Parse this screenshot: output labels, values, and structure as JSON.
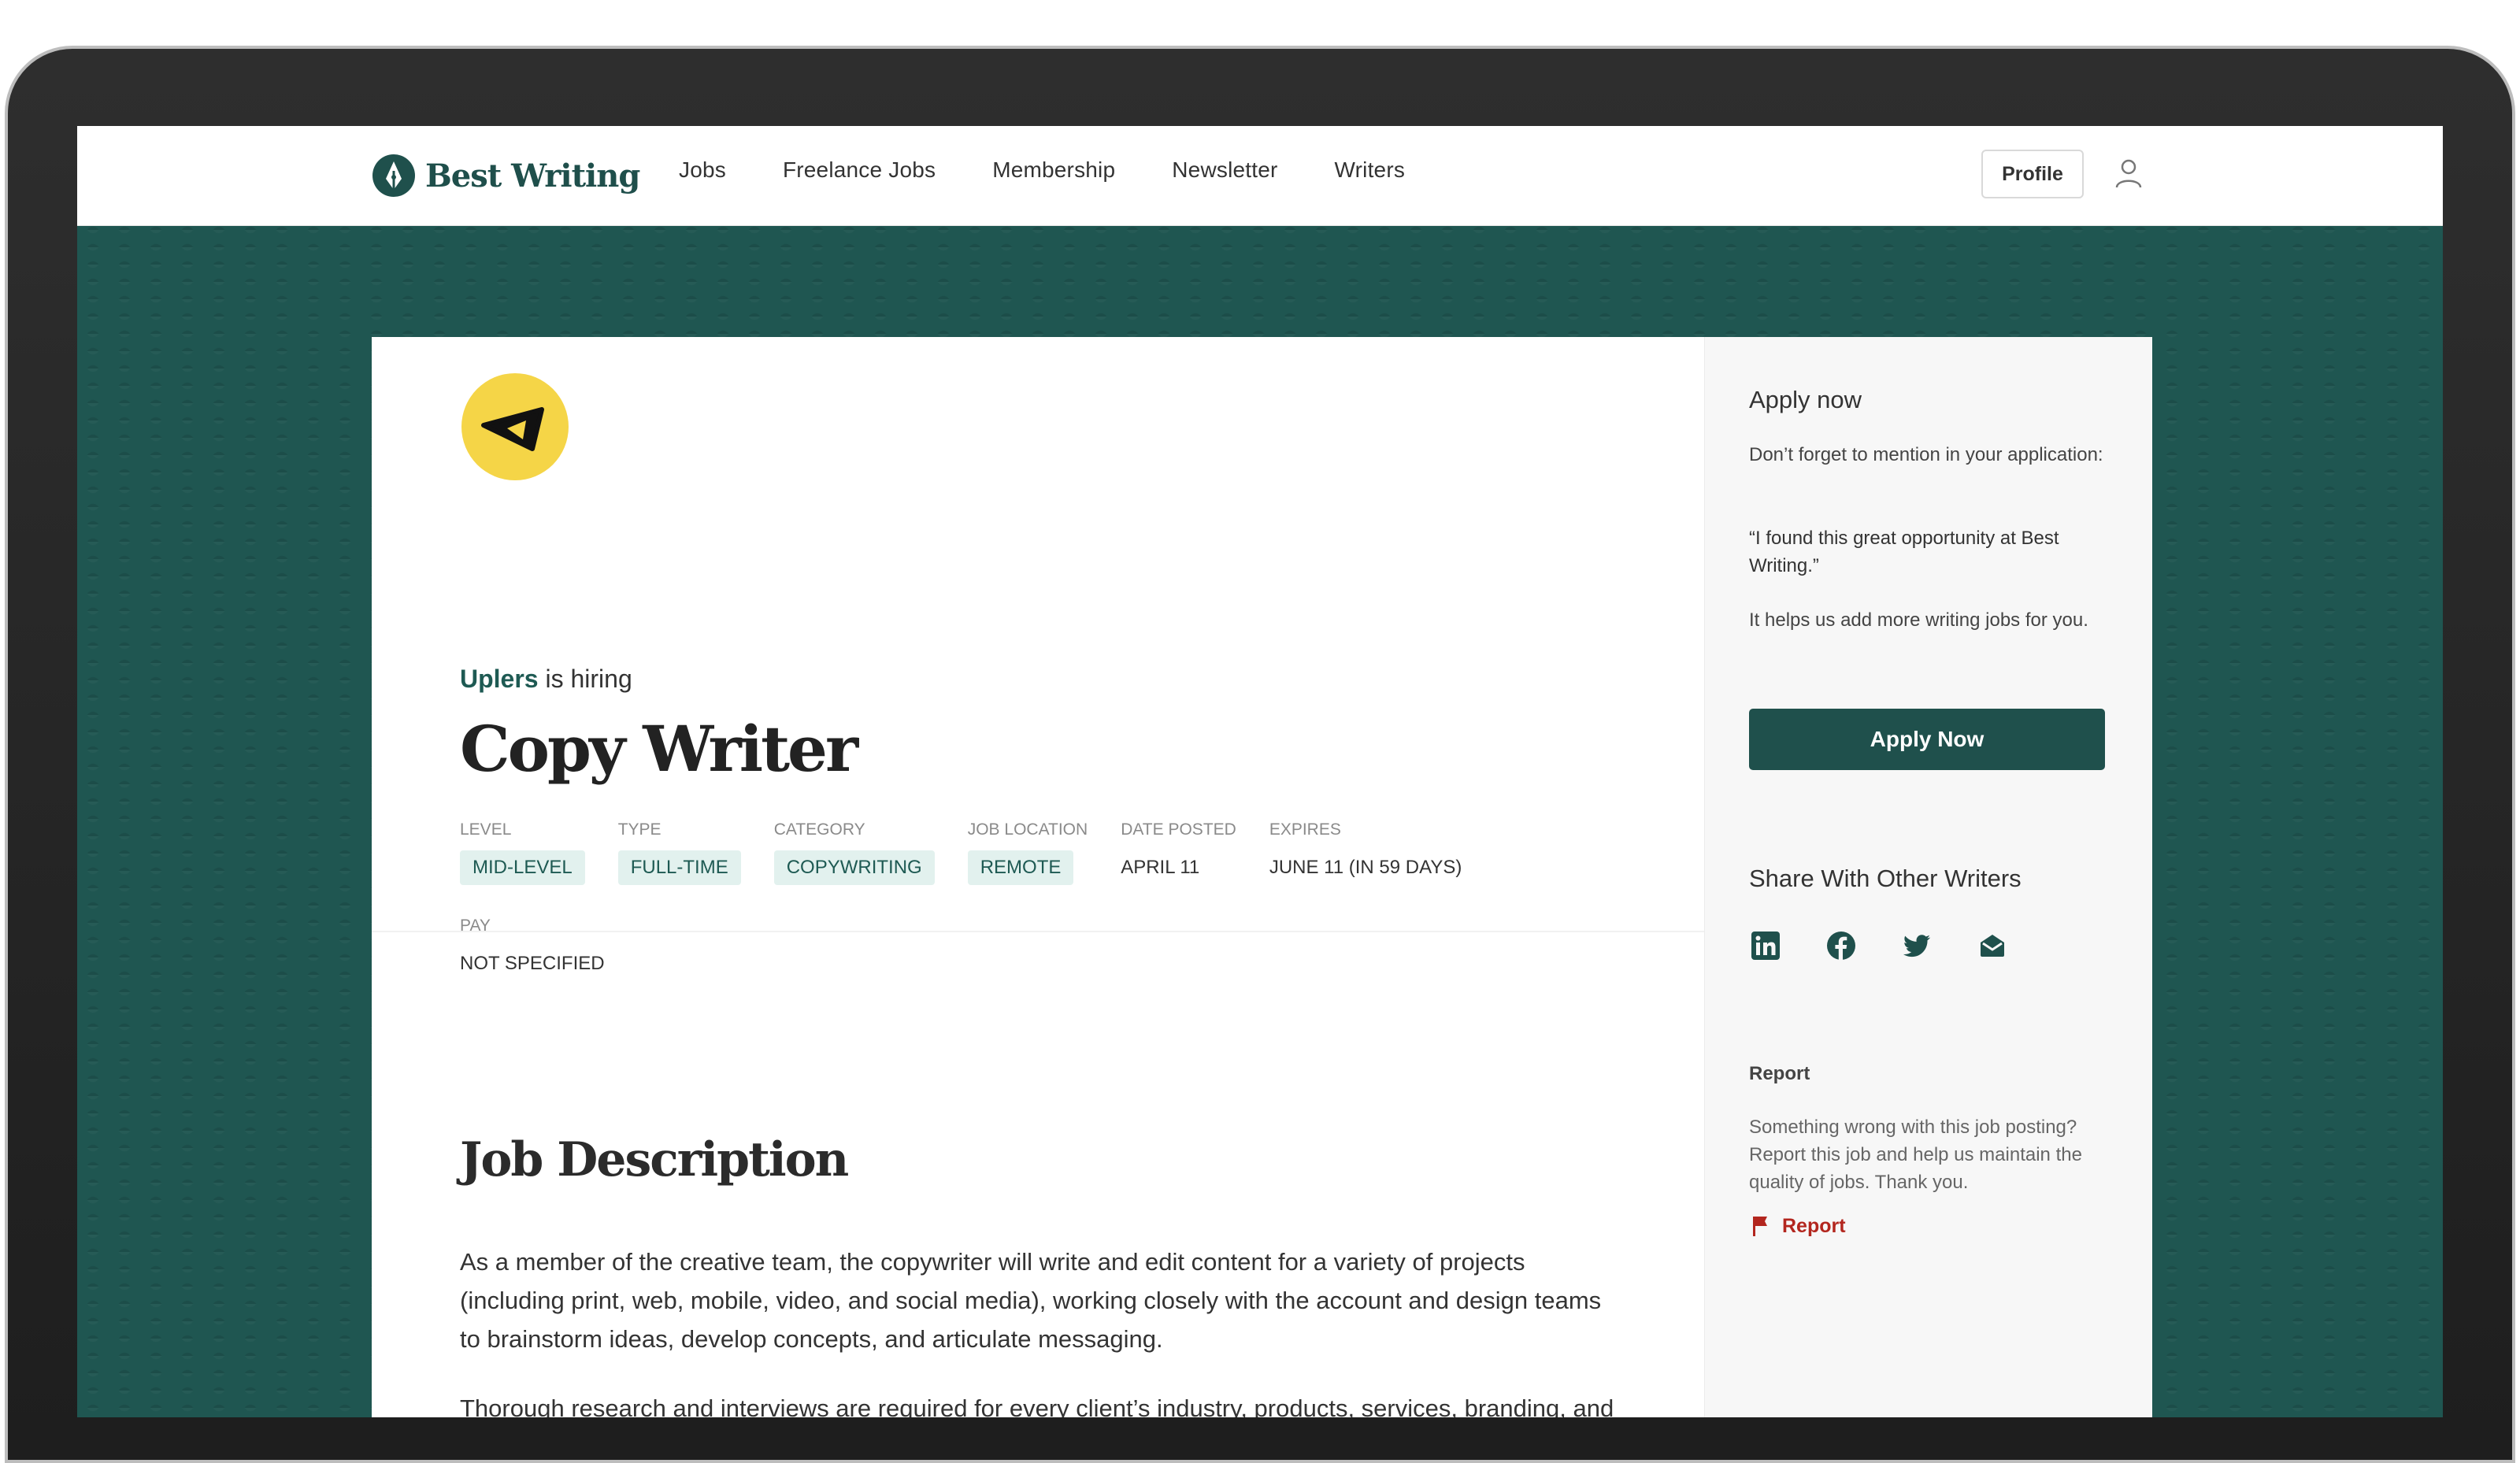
{
  "nav": {
    "brand": "Best Writing",
    "links": [
      "Jobs",
      "Freelance Jobs",
      "Membership",
      "Newsletter",
      "Writers"
    ],
    "profile_label": "Profile"
  },
  "job": {
    "company": "Uplers",
    "hiring_suffix": "is hiring",
    "title": "Copy Writer",
    "meta": [
      {
        "label": "LEVEL",
        "value": "MID-LEVEL",
        "chip": true
      },
      {
        "label": "TYPE",
        "value": "FULL-TIME",
        "chip": true
      },
      {
        "label": "CATEGORY",
        "value": "COPYWRITING",
        "chip": true
      },
      {
        "label": "JOB LOCATION",
        "value": "REMOTE",
        "chip": true
      },
      {
        "label": "DATE POSTED",
        "value": "APRIL 11",
        "chip": false
      },
      {
        "label": "EXPIRES",
        "value": "JUNE 11 (IN 59 DAYS)",
        "chip": false
      }
    ],
    "pay": {
      "label": "PAY",
      "value": "NOT SPECIFIED"
    }
  },
  "description": {
    "heading": "Job Description",
    "paragraphs": [
      "As a member of the creative team, the copywriter will write and edit content for a variety of projects (including print, web, mobile, video, and social media), working closely with the account and design teams to brainstorm ideas, develop concepts, and articulate messaging.",
      "Thorough research and interviews are required for every client’s industry, products, services, branding, and marketing. The most successful candidate will be a quick learner who has a versatile writing style."
    ]
  },
  "sidebar": {
    "apply_heading": "Apply now",
    "apply_note": "Don’t forget to mention in your application:",
    "apply_quote": "“I found this great opportunity at Best Writing.”",
    "apply_helps": "It helps us add more writing jobs for you.",
    "apply_button": "Apply Now",
    "share_heading": "Share With Other Writers",
    "share_icons": [
      "linkedin-icon",
      "facebook-icon",
      "twitter-icon",
      "email-icon"
    ],
    "report_heading": "Report",
    "report_desc": "Something wrong with this job posting? Report this job and help us maintain the quality of jobs. Thank you.",
    "report_link": "Report"
  },
  "colors": {
    "brand": "#1f504c",
    "background": "#1f5651",
    "chip_bg": "#e2f1ee",
    "logo_yellow": "#f5d547",
    "report_red": "#b3261e"
  }
}
